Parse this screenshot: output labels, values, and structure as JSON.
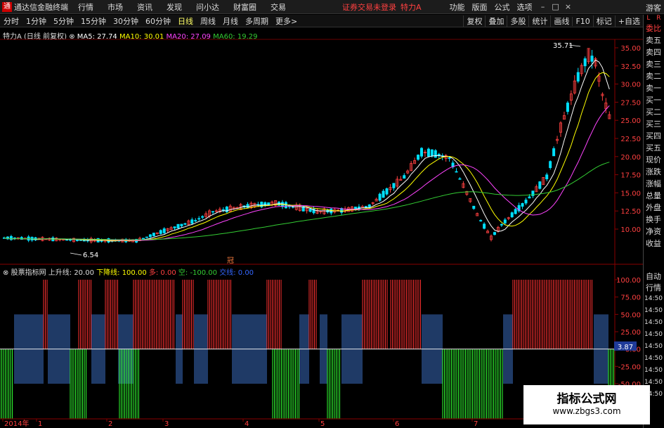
{
  "menubar": {
    "app_title": "通达信金融终端",
    "items": [
      "行情",
      "市场",
      "资讯",
      "发现",
      "问小达",
      "财富圈",
      "交易"
    ],
    "login_status": "证券交易未登录",
    "stock_title": "特力A",
    "right_links": [
      "功能",
      "版面",
      "公式",
      "选项"
    ],
    "guest": "游客"
  },
  "tabbar": {
    "periods": [
      "分时",
      "1分钟",
      "5分钟",
      "15分钟",
      "30分钟",
      "60分钟",
      "日线",
      "周线",
      "月线",
      "多周期",
      "更多>"
    ],
    "active_period": "日线",
    "tools": [
      "复权",
      "叠加",
      "多股",
      "统计",
      "画线",
      "F10",
      "标记",
      "+自选"
    ]
  },
  "ma_legend": {
    "stock": "特力A",
    "mode": "(日线 前复权)",
    "ma5": "MA5: 27.74",
    "ma10": "MA10: 30.01",
    "ma20": "MA20: 27.09",
    "ma60": "MA60: 19.29",
    "colors": {
      "ma5": "#ffffff",
      "ma10": "#ffff00",
      "ma20": "#ff44ff",
      "ma60": "#33cc33"
    }
  },
  "indicator_legend": {
    "name": "股票指标网",
    "up": "上升线: 20.00",
    "down": "下降线: 100.00",
    "duo": "多: 0.00",
    "kong": "空: -100.00",
    "jiaoxian": "交线: 0.00"
  },
  "price_axis": [
    "35.00",
    "32.50",
    "30.00",
    "27.50",
    "25.00",
    "22.50",
    "20.00",
    "17.50",
    "15.00",
    "12.50",
    "10.00"
  ],
  "price_annotations": {
    "high": "35.71",
    "low": "6.54"
  },
  "indicator_axis": [
    "100.00",
    "75.00",
    "50.00",
    "25.00",
    "0.00",
    "-25.00",
    "-50.00",
    "-75.00"
  ],
  "indicator_current": "3.87",
  "time_axis": [
    "2014年",
    "1",
    "2",
    "3",
    "4",
    "5",
    "6",
    "7"
  ],
  "time_marker": "冠",
  "sidepanel": {
    "top": [
      "L",
      "R"
    ],
    "labels": [
      "委比",
      "卖五",
      "卖四",
      "卖三",
      "卖二",
      "卖一",
      "买一",
      "买二",
      "买三",
      "买四",
      "买五",
      "现价",
      "涨跌",
      "涨幅",
      "总量",
      "外盘",
      "换手",
      "净资",
      "收益"
    ],
    "lower_labels": [
      "自动",
      "行情"
    ],
    "times": [
      "14:50",
      "14:50",
      "14:50",
      "14:50",
      "14:50",
      "14:50",
      "14:50",
      "14:50",
      "14:50"
    ]
  },
  "watermark": {
    "line1": "指标公式网",
    "line2": "www.zbgs3.com"
  }
}
